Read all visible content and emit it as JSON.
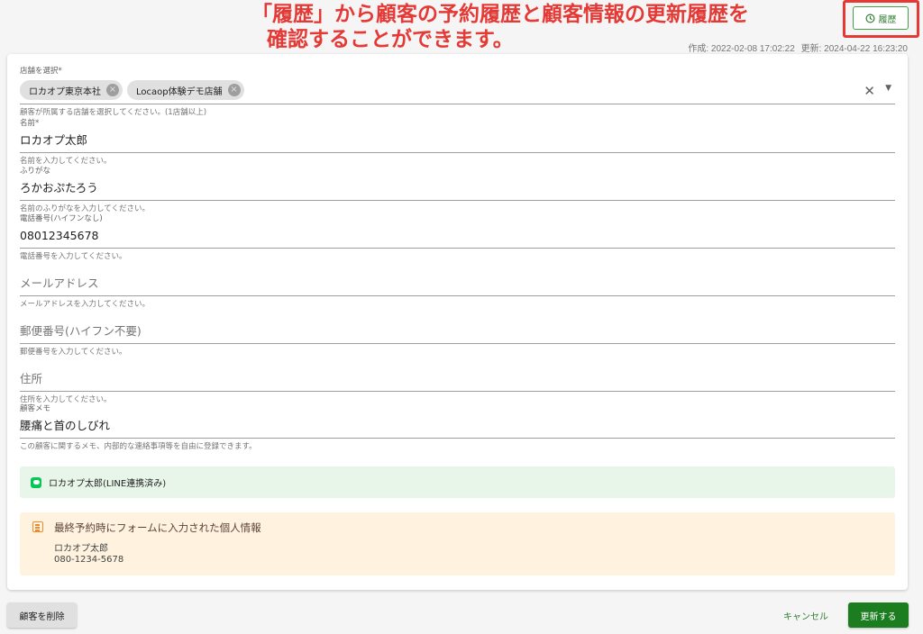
{
  "annotation": {
    "line1": "「履歴」から顧客の予約履歴と顧客情報の更新履歴を",
    "line2": "確認することができます。"
  },
  "header": {
    "history_button": "履歴",
    "history_icon": "clock-icon",
    "created": "作成: 2022-02-08 17:02:22",
    "updated": "更新: 2024-04-22 16:23:20"
  },
  "form": {
    "stores": {
      "label": "店舗を選択*",
      "chips": [
        "ロカオプ東京本社",
        "Locaop体験デモ店舗"
      ],
      "hint": "顧客が所属する店舗を選択してください。(1店舗以上)"
    },
    "name": {
      "label": "名前*",
      "value": "ロカオプ太郎",
      "hint": "名前を入力してください。"
    },
    "furigana": {
      "label": "ふりがな",
      "value": "ろかおぷたろう",
      "hint": "名前のふりがなを入力してください。"
    },
    "phone": {
      "label": "電話番号(ハイフンなし)",
      "value": "08012345678",
      "hint": "電話番号を入力してください。"
    },
    "email": {
      "placeholder": "メールアドレス",
      "hint": "メールアドレスを入力してください。"
    },
    "postal": {
      "placeholder": "郵便番号(ハイフン不要)",
      "hint": "郵便番号を入力してください。"
    },
    "address": {
      "placeholder": "住所",
      "hint": "住所を入力してください。"
    },
    "memo": {
      "label": "顧客メモ",
      "value": "腰痛と首のしびれ",
      "hint": "この顧客に関するメモ、内部的な連絡事項等を自由に登録できます。"
    }
  },
  "line_status": {
    "text": "ロカオプ太郎(LINE連携済み)",
    "color": "#06c755"
  },
  "last_reservation": {
    "title": "最終予約時にフォームに入力された個人情報",
    "name": "ロカオプ太郎",
    "phone": "080-1234-5678"
  },
  "footer": {
    "delete": "顧客を削除",
    "cancel": "キャンセル",
    "update": "更新する"
  },
  "colors": {
    "accent": "#1b7d1f",
    "annotation": "#e53935"
  }
}
